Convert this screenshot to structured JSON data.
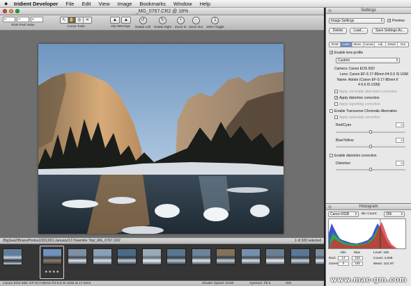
{
  "menubar": {
    "apple": "",
    "items": [
      "Iridient Developer",
      "File",
      "Edit",
      "View",
      "Image",
      "Bookmarks",
      "Window",
      "Help"
    ]
  },
  "window": {
    "title": "_MG_0767.CR2 @ 18%"
  },
  "toolbar": {
    "rgb_label": "RGB Pixel Value",
    "rgb_r": "R",
    "rgb_g": "G",
    "rgb_b": "B",
    "cursor_tools_label": "Cursor Tools",
    "clip_warnings_label": "Clip Warnings",
    "rotate_left_label": "Rotate Left",
    "rotate_right_label": "Rotate Right",
    "zoom_in_label": "Zoom In",
    "zoom_out_label": "Zoom Out",
    "toggle_100_label": "100% Toggle"
  },
  "pathbar": {
    "path": "/BigSea2/BriansPhotos2/2013/01 January/13 Yosemite Trip/_MG_0767.CR2",
    "count": "1 of 320 selected"
  },
  "filmstrip": {
    "thumbnail_count": 13,
    "selected_index": 1,
    "stars": "★★★★"
  },
  "statusbar": {
    "camera": "Canon EOS 50D: EF-S17-85mm f/4-5.6 IS USM at 17.0mm",
    "shutter": "Shutter Speed: 1/100",
    "aperture": "Aperture: f/8.0",
    "iso": "ISO"
  },
  "settings": {
    "title": "Settings",
    "preset": "Image Settings",
    "preview_label": "Preview",
    "preview_checked": true,
    "buttons": {
      "delete": "Delete",
      "load": "Load...",
      "save_as": "Save Settings As..."
    },
    "tabs": [
      "RAW",
      "Lens",
      "Mono",
      "Curves",
      "Adj",
      "Detail",
      "Out"
    ],
    "active_tab": 1,
    "enable_lens_profile": "Enable lens profile",
    "profile_select": "Custom",
    "camera_line": "Camera: Canon EOS 50D",
    "lens_line1": "Lens: Canon EF-S 17-85mm f/4-5.6 IS USM",
    "name_line1": "Name: Adobe (Canon EF-S 17-85mm f/",
    "name_line2": "4-5.6 IS USM)",
    "apply_ca": "Apply chromatic aberration correction",
    "apply_distortion": "Apply distortion correction",
    "apply_vignetting": "Apply vignetting correction",
    "enable_transverse": "Enable Transverse Chromatic Aberration",
    "apply_auto": "Apply automatic correction",
    "red_cyan": "Red/Cyan",
    "red_cyan_value": "0",
    "blue_yellow": "Blue/Yellow",
    "blue_yellow_value": "0",
    "enable_distortion": "Enable distortion correction",
    "distortion": "Distortion",
    "distortion_value": "0"
  },
  "histogram": {
    "title": "Histogram",
    "space": "Canon RGB",
    "bin_count_label": "Bin Count:",
    "bin_count": "256",
    "head_min": "Min",
    "head_max": "Max",
    "red_label": "Red:",
    "red_min": "14",
    "red_max": "233",
    "green_label": "Green:",
    "green_min": "0",
    "green_max": "245",
    "level": "Level: 185",
    "count": "Count: 4,938",
    "mean": "Mean: 101.97"
  },
  "watermark": "www.mac-gm.com",
  "colors": {
    "tab_active": "#6e8fc2",
    "window_bg": "#6f6f6f",
    "filmstrip_bg": "#353535"
  }
}
